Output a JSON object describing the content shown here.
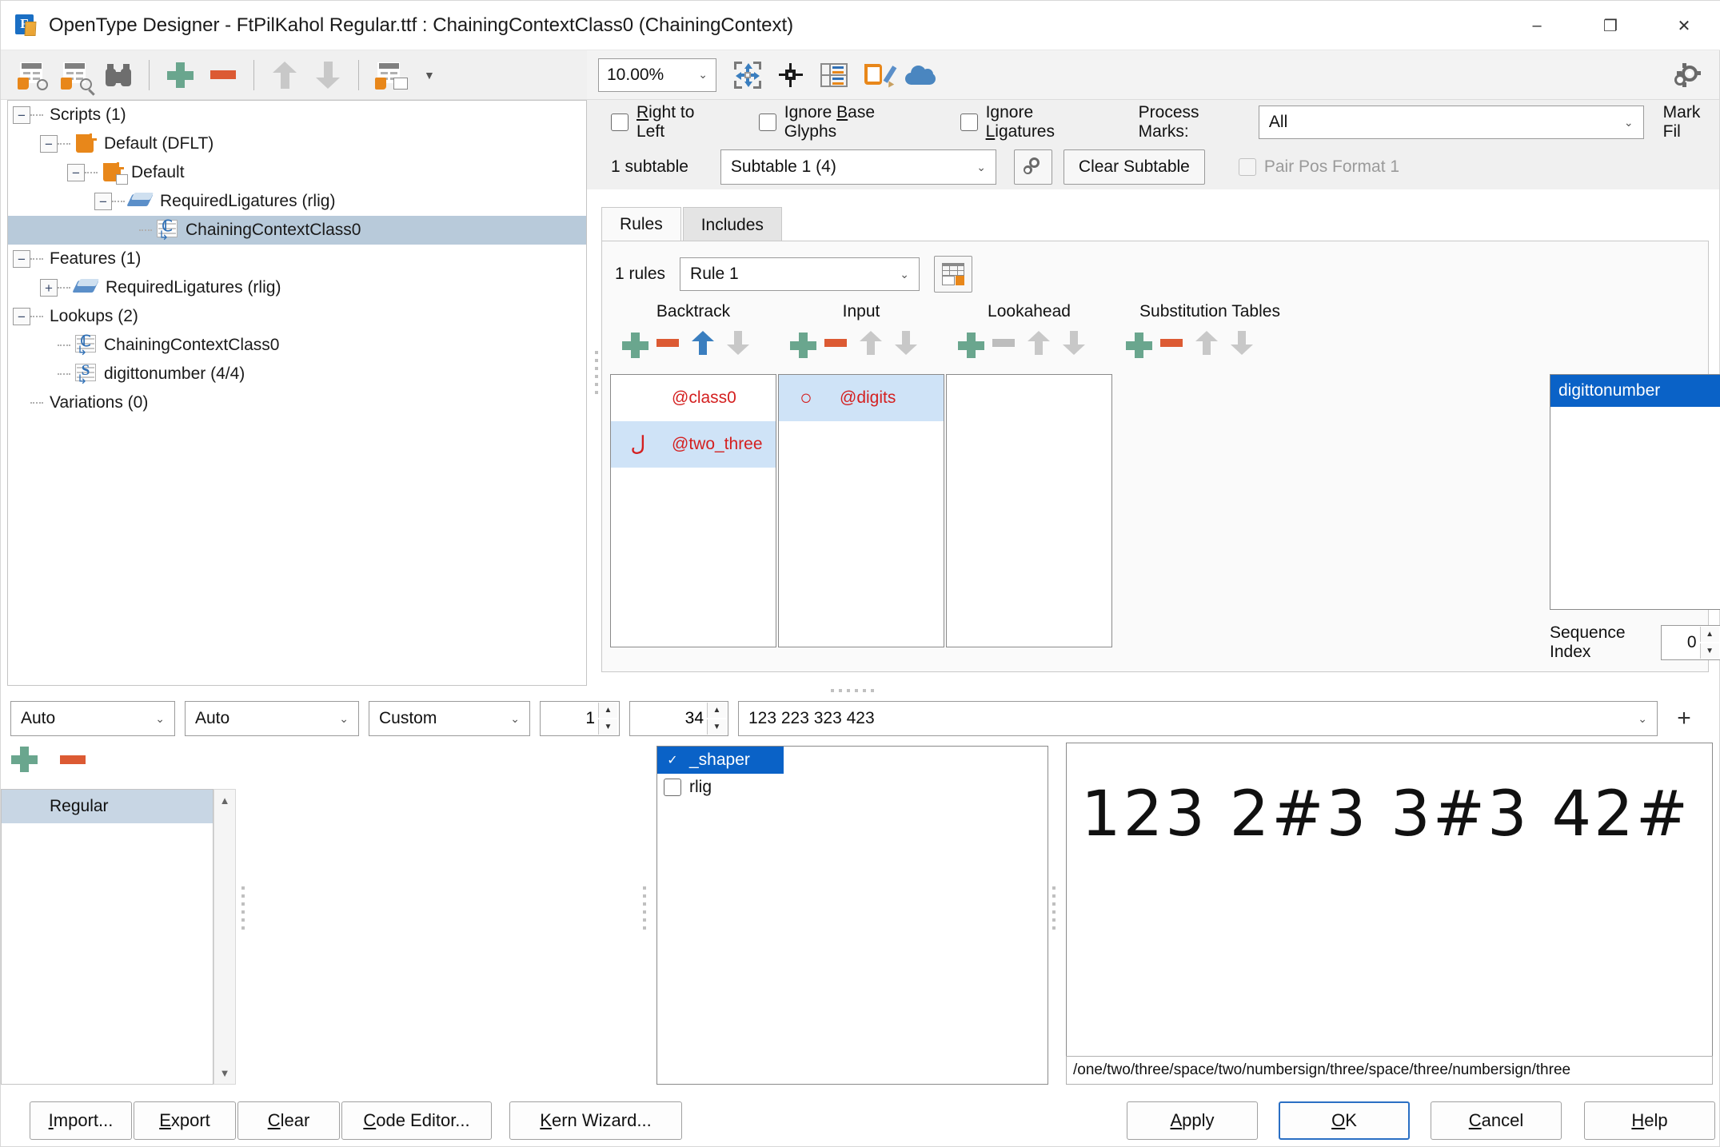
{
  "window": {
    "title": "OpenType Designer - FtPilKahol Regular.ttf : ChainingContextClass0 (ChainingContext)",
    "app_letter": "F",
    "minimize": "–",
    "maximize": "❐",
    "close": "✕"
  },
  "left_toolbar": {
    "items": [
      {
        "name": "compile-font-icon"
      },
      {
        "name": "preview-font-icon"
      },
      {
        "name": "binocular-search-icon"
      },
      {
        "name": "add-icon"
      },
      {
        "name": "remove-icon"
      },
      {
        "name": "move-up-icon"
      },
      {
        "name": "move-down-icon"
      },
      {
        "name": "table-properties-icon"
      }
    ]
  },
  "tree": {
    "rows": [
      {
        "indent": 0,
        "twist": "−",
        "icon": "none",
        "label": "Scripts (1)",
        "selected": false
      },
      {
        "indent": 1,
        "twist": "−",
        "icon": "script",
        "label": "Default (DFLT)",
        "selected": false
      },
      {
        "indent": 2,
        "twist": "−",
        "icon": "langsys",
        "label": "Default",
        "selected": false
      },
      {
        "indent": 3,
        "twist": "−",
        "icon": "feature",
        "label": "RequiredLigatures (rlig)",
        "selected": false
      },
      {
        "indent": 4,
        "twist": "",
        "icon": "lookup",
        "label": "ChainingContextClass0",
        "selected": true
      },
      {
        "indent": 0,
        "twist": "−",
        "icon": "none",
        "label": "Features (1)",
        "selected": false
      },
      {
        "indent": 1,
        "twist": "+",
        "icon": "feature",
        "label": "RequiredLigatures (rlig)",
        "selected": false
      },
      {
        "indent": 0,
        "twist": "−",
        "icon": "none",
        "label": "Lookups (2)",
        "selected": false
      },
      {
        "indent": 1,
        "twist": "",
        "icon": "lookup",
        "label": "ChainingContextClass0",
        "selected": false
      },
      {
        "indent": 1,
        "twist": "",
        "icon": "lookup_s",
        "label": "digittonumber (4/4)",
        "selected": false
      },
      {
        "indent": 0,
        "twist": "",
        "icon": "none",
        "label": "Variations (0)",
        "selected": false
      }
    ]
  },
  "right_toolbar": {
    "zoom_value": "10.00%",
    "fit_icon": "fit-to-window-icon",
    "anchor_icon": "anchor-point-icon",
    "classes_icon": "glyph-classes-icon",
    "edit_icon": "edit-glyph-icon",
    "cloud_icon": "cloud-icon",
    "settings_icon": "settings-gear-icon"
  },
  "options": {
    "right_to_left": {
      "label_pre": "",
      "label_u": "R",
      "label_post": "ight to Left",
      "checked": false
    },
    "ignore_base_glyphs": {
      "label_pre": "Ignore ",
      "label_u": "B",
      "label_post": "ase Glyphs",
      "checked": false
    },
    "ignore_ligatures": {
      "label_pre": "Ignore ",
      "label_u": "L",
      "label_post": "igatures",
      "checked": false
    },
    "process_marks_label": "Process Marks:",
    "process_marks_value": "All",
    "mark_filter_label": "Mark Fil"
  },
  "subtable": {
    "count_label": "1 subtable",
    "selected": "Subtable 1 (4)",
    "settings_icon": "subtable-settings-icon",
    "clear_label": "Clear Subtable",
    "pair_pos_label": "Pair Pos Format 1",
    "pair_pos_checked": false
  },
  "tabs": [
    {
      "label": "Rules",
      "active": true
    },
    {
      "label": "Includes",
      "active": false
    }
  ],
  "rules": {
    "count_label": "1 rules",
    "selected_rule": "Rule 1",
    "grid_icon": "rule-table-icon",
    "columns": [
      {
        "key": "backtrack",
        "header": "Backtrack",
        "buttons": [
          {
            "name": "add-icon",
            "state": "green"
          },
          {
            "name": "remove-icon",
            "state": "red"
          },
          {
            "name": "move-up-icon",
            "state": "blue"
          },
          {
            "name": "move-down-icon",
            "state": "grey"
          }
        ],
        "items": [
          {
            "glyph": "",
            "name": "@class0",
            "selected": false
          },
          {
            "glyph": "ل",
            "name": "@two_three",
            "selected": true
          }
        ]
      },
      {
        "key": "input",
        "header": "Input",
        "buttons": [
          {
            "name": "add-icon",
            "state": "green"
          },
          {
            "name": "remove-icon",
            "state": "red"
          },
          {
            "name": "move-up-icon",
            "state": "grey"
          },
          {
            "name": "move-down-icon",
            "state": "grey"
          }
        ],
        "items": [
          {
            "glyph": "○",
            "name": "@digits",
            "selected": true
          }
        ]
      },
      {
        "key": "lookahead",
        "header": "Lookahead",
        "buttons": [
          {
            "name": "add-icon",
            "state": "green"
          },
          {
            "name": "remove-icon",
            "state": "greydash"
          },
          {
            "name": "move-up-icon",
            "state": "grey"
          },
          {
            "name": "move-down-icon",
            "state": "grey"
          }
        ],
        "items": []
      },
      {
        "key": "substitution",
        "header": "Substitution Tables",
        "buttons": [
          {
            "name": "add-icon",
            "state": "green"
          },
          {
            "name": "remove-icon",
            "state": "red"
          },
          {
            "name": "move-up-icon",
            "state": "grey"
          },
          {
            "name": "move-down-icon",
            "state": "grey"
          }
        ],
        "items": [
          {
            "glyph": "",
            "name": "digittonumber",
            "selected": true
          }
        ]
      }
    ],
    "sequence_index_label": "Sequence Index",
    "sequence_index_value": "0"
  },
  "bottom_bar": {
    "select_1": "Auto",
    "select_2": "Auto",
    "select_3": "Custom",
    "spinner_1": "1",
    "spinner_2": "34",
    "sample_text": "123 223 323 423",
    "add_label": "+"
  },
  "masters": {
    "add_icon": "add-master-icon",
    "remove_icon": "remove-master-icon",
    "items": [
      {
        "label": "Regular",
        "selected": true
      }
    ],
    "scroll_up": "▲",
    "scroll_down": "▼"
  },
  "features": {
    "items": [
      {
        "label": "_shaper",
        "checked": true,
        "selected": true
      },
      {
        "label": "rlig",
        "checked": false,
        "selected": false
      }
    ]
  },
  "preview": {
    "text": "123  2#3  3#3  42#",
    "status": "/one/two/three/space/two/numbersign/three/space/three/numbersign/three"
  },
  "footer": {
    "buttons": [
      {
        "label_u": "I",
        "label_post": "mport...",
        "primary": false,
        "name": "import-button"
      },
      {
        "label_u": "E",
        "label_post": "xport",
        "primary": false,
        "name": "export-button"
      },
      {
        "label_u": "C",
        "label_post": "lear",
        "primary": false,
        "name": "clear-button"
      },
      {
        "label_u": "C",
        "label_post": "ode Editor...",
        "primary": false,
        "name": "code-editor-button"
      },
      {
        "label_u": "K",
        "label_post": "ern Wizard...",
        "primary": false,
        "name": "kern-wizard-button"
      },
      {
        "label_u": "A",
        "label_post": "pply",
        "primary": false,
        "name": "apply-button"
      },
      {
        "label_u": "O",
        "label_post": "K",
        "primary": true,
        "name": "ok-button"
      },
      {
        "label_u": "C",
        "label_post": "ancel",
        "primary": false,
        "name": "cancel-button"
      },
      {
        "label_u": "H",
        "label_post": "elp",
        "primary": false,
        "name": "help-button"
      }
    ]
  },
  "colors": {
    "accent": "#0a62c7",
    "green": "#6aa68e",
    "red": "#dc5a33",
    "glyph_red": "#d42020",
    "selection": "#b8cada"
  }
}
